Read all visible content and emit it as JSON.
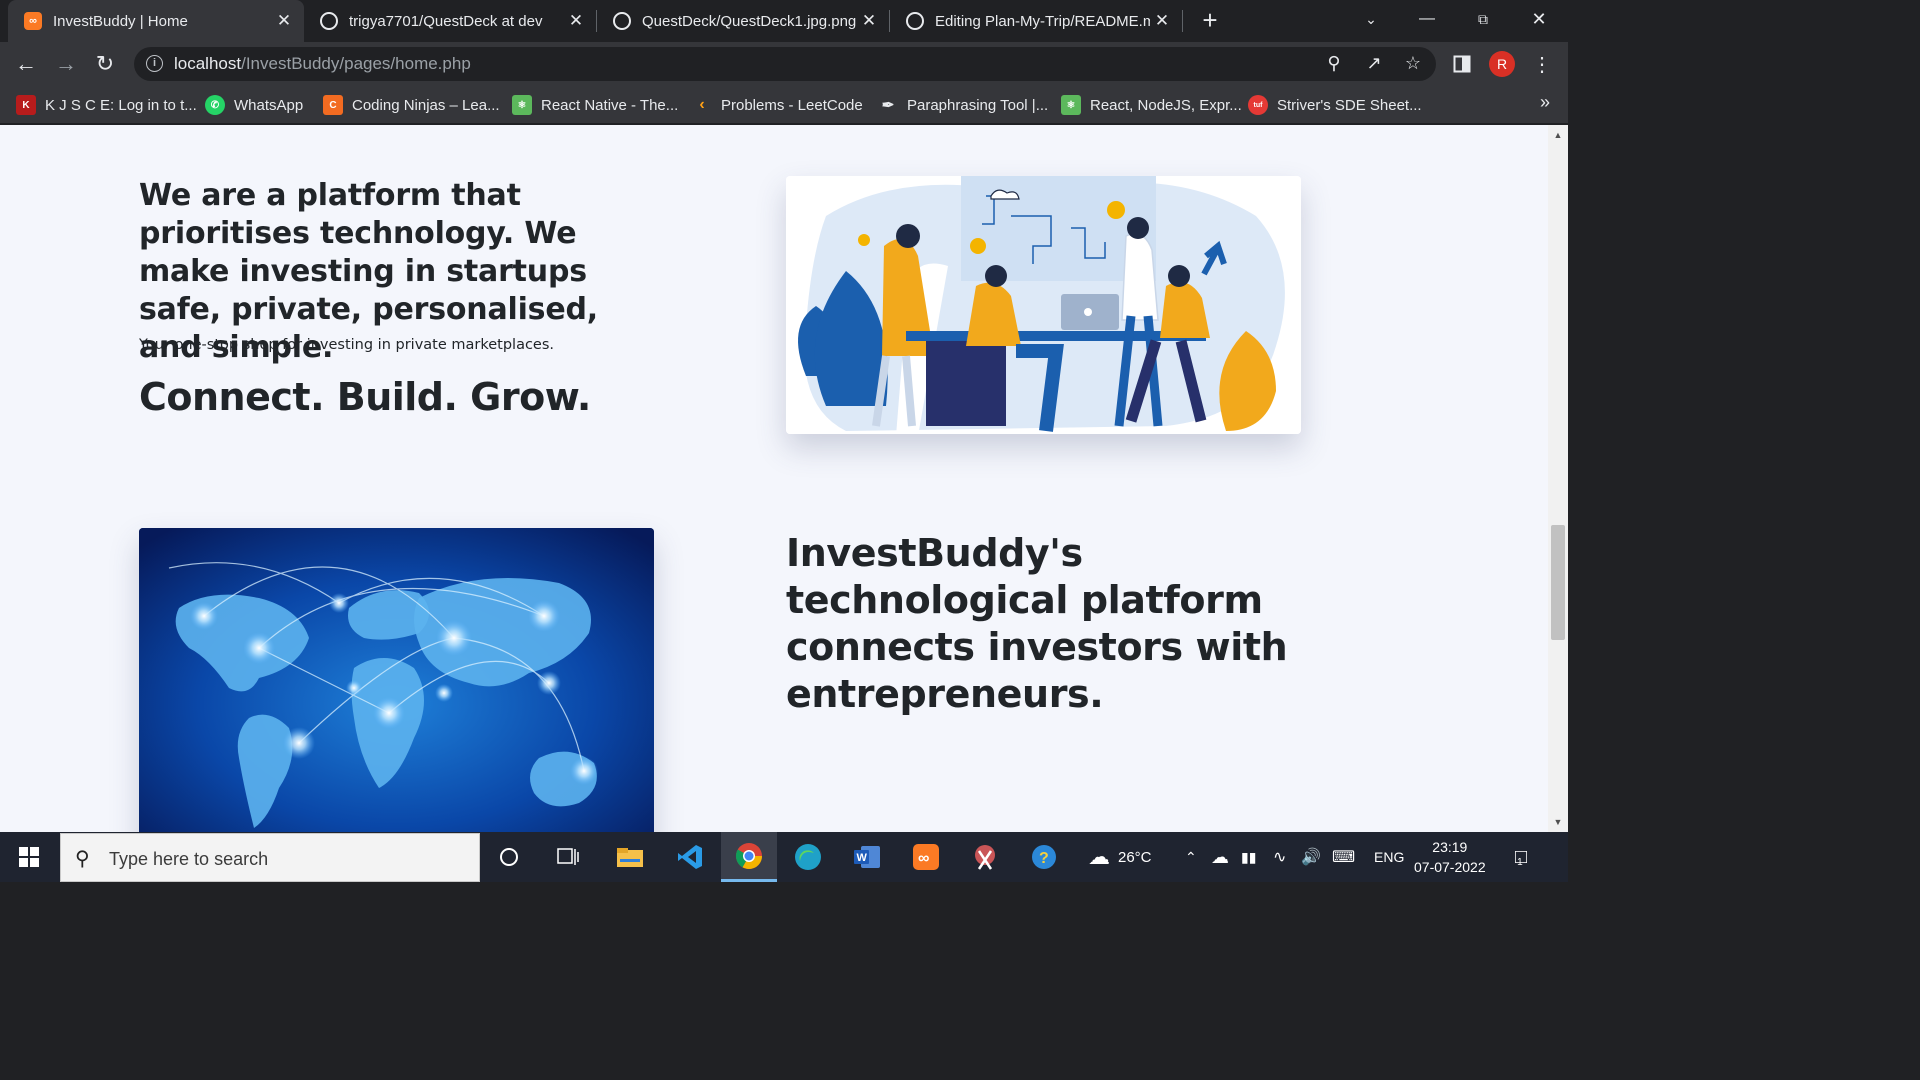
{
  "browser": {
    "tabs": [
      {
        "title": "InvestBuddy | Home",
        "icon": "xampp-icon",
        "active": true
      },
      {
        "title": "trigya7701/QuestDeck at dev",
        "icon": "github-icon",
        "active": false
      },
      {
        "title": "QuestDeck/QuestDeck1.jpg.png",
        "icon": "github-icon",
        "active": false
      },
      {
        "title": "Editing Plan-My-Trip/README.m",
        "icon": "github-icon",
        "active": false
      }
    ],
    "url_host": "localhost",
    "url_path": "/InvestBuddy/pages/home.php",
    "profile_initial": "R",
    "bookmarks": [
      {
        "label": "K J S C E: Log in to t...",
        "icon": "kjsce-icon",
        "color": "#b71c1c"
      },
      {
        "label": "WhatsApp",
        "icon": "whatsapp-icon",
        "color": "#25d366"
      },
      {
        "label": "Coding Ninjas – Lea...",
        "icon": "coding-ninjas-icon",
        "color": "#f26b21"
      },
      {
        "label": "React Native - The...",
        "icon": "react-native-icon",
        "color": "#5cb85c"
      },
      {
        "label": "Problems - LeetCode",
        "icon": "leetcode-icon",
        "color": "#ffa116"
      },
      {
        "label": "Paraphrasing Tool |...",
        "icon": "quill-icon",
        "color": "#e8eaed"
      },
      {
        "label": "React, NodeJS, Expr...",
        "icon": "react-node-icon",
        "color": "#5cb85c"
      },
      {
        "label": "Striver's SDE Sheet...",
        "icon": "tuf-icon",
        "color": "#e53935"
      }
    ]
  },
  "page": {
    "hero": {
      "heading_plain": "We are a platform that prioritises technology. We make investing in startups ",
      "heading_bold": "safe, private, personalised, and simple.",
      "subtext": "Your one-stop shop for investing in private marketplaces.",
      "tagline": "Connect. Build. Grow."
    },
    "second": {
      "heading": "InvestBuddy's technological platform connects investors with entrepreneurs."
    }
  },
  "taskbar": {
    "search_placeholder": "Type here to search",
    "weather": "26°C",
    "language": "ENG",
    "time": "23:19",
    "date": "07-07-2022",
    "notification_count": "1"
  }
}
